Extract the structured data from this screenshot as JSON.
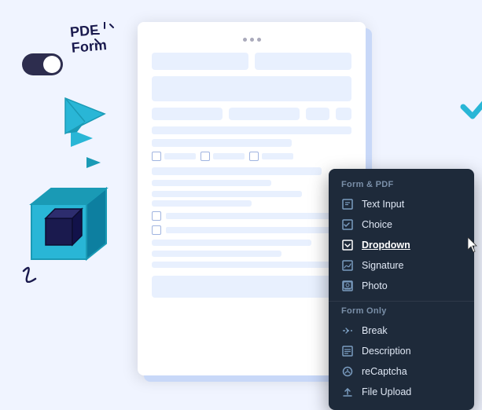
{
  "decorations": {
    "pdf_label_line1": "PDF",
    "pdf_label_line2": "Form"
  },
  "document": {
    "dots": [
      "dot1",
      "dot2",
      "dot3"
    ]
  },
  "menu": {
    "section1_label": "Form & PDF",
    "section2_label": "Form Only",
    "items_form_pdf": [
      {
        "id": "text-input",
        "label": "Text Input",
        "icon": "text-input-icon"
      },
      {
        "id": "choice",
        "label": "Choice",
        "icon": "choice-icon"
      },
      {
        "id": "dropdown",
        "label": "Dropdown",
        "icon": "dropdown-icon",
        "active": true
      },
      {
        "id": "signature",
        "label": "Signature",
        "icon": "signature-icon"
      },
      {
        "id": "photo",
        "label": "Photo",
        "icon": "photo-icon"
      }
    ],
    "items_form_only": [
      {
        "id": "break",
        "label": "Break",
        "icon": "break-icon"
      },
      {
        "id": "description",
        "label": "Description",
        "icon": "description-icon"
      },
      {
        "id": "recaptcha",
        "label": "reCaptcha",
        "icon": "recaptcha-icon"
      },
      {
        "id": "file-upload",
        "label": "File Upload",
        "icon": "file-upload-icon"
      }
    ]
  }
}
